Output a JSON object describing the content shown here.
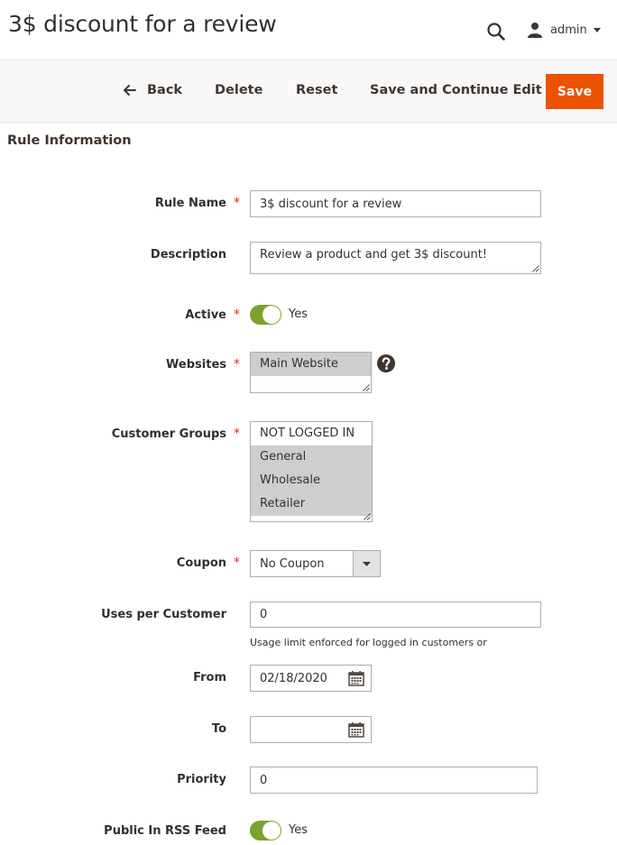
{
  "header": {
    "title": "3$ discount for a review",
    "user_name": "admin"
  },
  "actions": {
    "back": "Back",
    "delete": "Delete",
    "reset": "Reset",
    "save_continue": "Save and Continue Edit",
    "save": "Save"
  },
  "section": {
    "title": "Rule Information"
  },
  "form": {
    "rule_name": {
      "label": "Rule Name",
      "required": "*",
      "value": "3$ discount for a review"
    },
    "description": {
      "label": "Description",
      "value": "Review a product and get 3$ discount!"
    },
    "active": {
      "label": "Active",
      "required": "*",
      "state": "Yes"
    },
    "websites": {
      "label": "Websites",
      "required": "*",
      "options": [
        "Main Website"
      ]
    },
    "customer_groups": {
      "label": "Customer Groups",
      "required": "*",
      "options": [
        "NOT LOGGED IN",
        "General",
        "Wholesale",
        "Retailer"
      ]
    },
    "coupon": {
      "label": "Coupon",
      "required": "*",
      "value": "No Coupon"
    },
    "uses_per_customer": {
      "label": "Uses per Customer",
      "value": "0",
      "note": "Usage limit enforced for logged in customers or"
    },
    "from": {
      "label": "From",
      "value": "02/18/2020"
    },
    "to": {
      "label": "To",
      "value": ""
    },
    "priority": {
      "label": "Priority",
      "value": "0"
    },
    "rss": {
      "label": "Public In RSS Feed",
      "state": "Yes"
    }
  },
  "colors": {
    "accent": "#eb5202",
    "toggle_on": "#79a22e",
    "required": "#e22626",
    "selected_option": "#cecece"
  },
  "icons": [
    "search-icon",
    "user-icon",
    "caret-down-icon",
    "back-arrow-icon",
    "help-icon",
    "calendar-icon",
    "chevron-down-icon"
  ]
}
